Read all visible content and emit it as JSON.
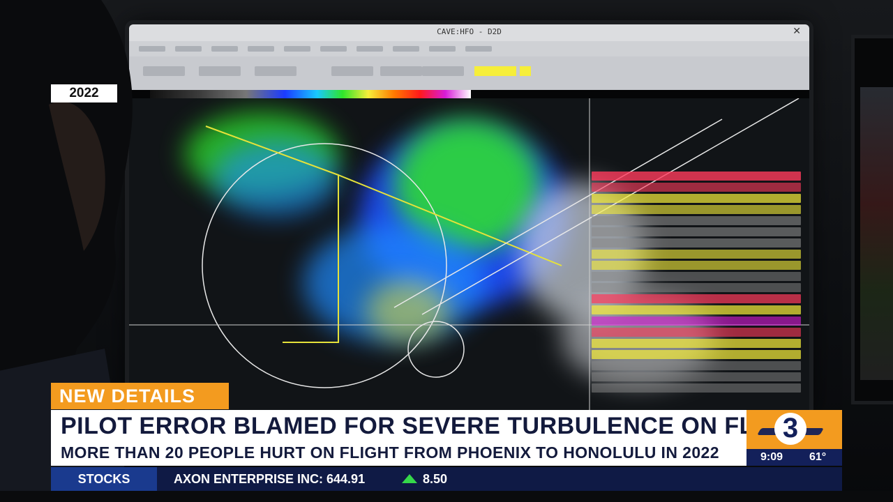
{
  "year_label": "2022",
  "tag": "NEW DETAILS",
  "headline": "PILOT ERROR BLAMED FOR SEVERE TURBULENCE ON FLIGHT",
  "subheadline": "MORE THAN 20 PEOPLE HURT ON FLIGHT FROM PHOENIX TO HONOLULU IN 2022",
  "station_logo": {
    "number": "3",
    "color": "#f39b1f"
  },
  "time": "9:09",
  "temperature": "61°",
  "ticker": {
    "label": "STOCKS",
    "stock": "AXON ENTERPRISE INC: 644.91",
    "change": "8.50",
    "change_direction": "up",
    "up_color": "#35d84a"
  },
  "monitor": {
    "window_title": "CAVE:HFO - D2D"
  },
  "colors": {
    "brand_orange": "#f39b1f",
    "brand_navy": "#13205a",
    "headline_text": "#131a3c"
  }
}
